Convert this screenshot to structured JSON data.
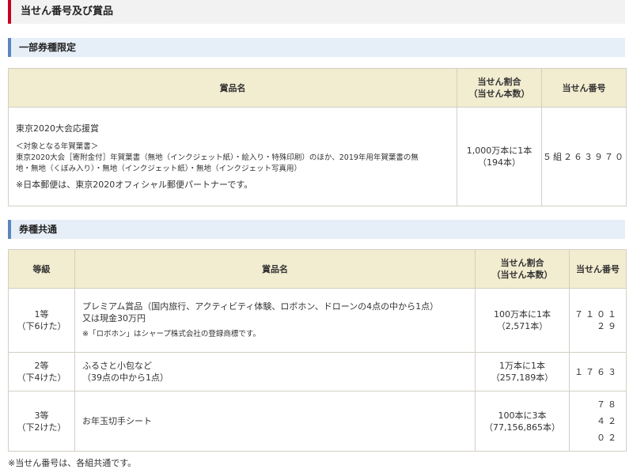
{
  "page_title": "当せん番号及び賞品",
  "section1": {
    "heading": "一部券種限定",
    "headers": {
      "prize": "賞品名",
      "ratio_line1": "当せん割合",
      "ratio_line2": "（当せん本数）",
      "number": "当せん番号"
    },
    "row": {
      "prize_title": "東京2020大会応援賞",
      "target_label": "＜対象となる年賀葉書＞",
      "target_line1": "東京2020大会［寄附金付］年賀葉書（無地（インクジェット紙）・絵入り・特殊印刷）のほか、2019年用年賀葉書の無",
      "target_line2": "地・無地（くぼみ入り）・無地（インクジェット紙）・無地（インクジェット写真用）",
      "partner_note": "※日本郵便は、東京2020オフィシャル郵便パートナーです。",
      "ratio_line1": "1,000万本に1本",
      "ratio_line2": "（194本）",
      "number": "５組２６３９７０"
    }
  },
  "section2": {
    "heading": "券種共通",
    "headers": {
      "grade": "等級",
      "prize": "賞品名",
      "ratio_line1": "当せん割合",
      "ratio_line2": "（当せん本数）",
      "number": "当せん番号"
    },
    "rows": [
      {
        "grade": "1等",
        "digits": "（下6けた）",
        "prize_line1": "プレミアム賞品（国内旅行、アクティビティ体験、ロボホン、ドローンの4点の中から1点）",
        "prize_line2": "又は現金30万円",
        "prize_note": "※「ロボホン」はシャープ株式会社の登録商標です。",
        "ratio_line1": "100万本に1本",
        "ratio_line2": "（2,571本）",
        "numbers": [
          "７１０１２９"
        ]
      },
      {
        "grade": "2等",
        "digits": "（下4けた）",
        "prize_line1": "ふるさと小包など",
        "prize_line2": "（39点の中から1点）",
        "ratio_line1": "1万本に1本",
        "ratio_line2": "（257,189本）",
        "numbers": [
          "１７６３"
        ]
      },
      {
        "grade": "3等",
        "digits": "（下2けた）",
        "prize_line1": "お年玉切手シート",
        "ratio_line1": "100本に3本",
        "ratio_line2": "（77,156,865本）",
        "numbers": [
          "７８",
          "４２",
          "０２"
        ]
      }
    ]
  },
  "footer_note": "※当せん番号は、各組共通です。",
  "colors": {
    "title_accent": "#c8001e",
    "section_accent": "#5b86bd",
    "table_header_bg": "#f2ecd0",
    "border": "#d3cfc4"
  }
}
